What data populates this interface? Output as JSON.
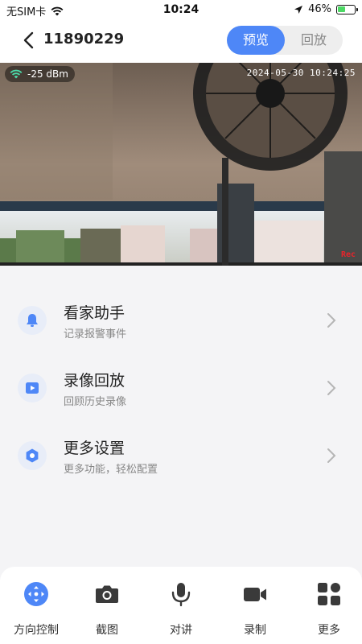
{
  "status_bar": {
    "carrier": "无SIM卡",
    "time": "10:24",
    "battery": "46%",
    "battery_level": 0.46
  },
  "header": {
    "device_id": "11890229",
    "tabs": [
      {
        "label": "预览",
        "active": true
      },
      {
        "label": "回放",
        "active": false
      }
    ]
  },
  "video": {
    "signal": "-25 dBm",
    "timestamp": "2024-05-30 10:24:25",
    "rec_label": "Rec"
  },
  "menu": {
    "items": [
      {
        "title": "看家助手",
        "subtitle": "记录报警事件",
        "icon": "bell-icon"
      },
      {
        "title": "录像回放",
        "subtitle": "回顾历史录像",
        "icon": "play-icon"
      },
      {
        "title": "更多设置",
        "subtitle": "更多功能，轻松配置",
        "icon": "hexagon-settings-icon"
      }
    ]
  },
  "toolbar": {
    "items": [
      {
        "label": "方向控制",
        "icon": "direction-control-icon"
      },
      {
        "label": "截图",
        "icon": "camera-icon"
      },
      {
        "label": "对讲",
        "icon": "microphone-icon"
      },
      {
        "label": "录制",
        "icon": "video-record-icon"
      },
      {
        "label": "更多",
        "icon": "grid-more-icon"
      }
    ]
  },
  "colors": {
    "accent": "#4e87f7",
    "icon_bg": "#e8edf8",
    "background": "#f4f4f6",
    "toolbar_icon": "#3a3a3a",
    "rec": "#e8242b"
  }
}
